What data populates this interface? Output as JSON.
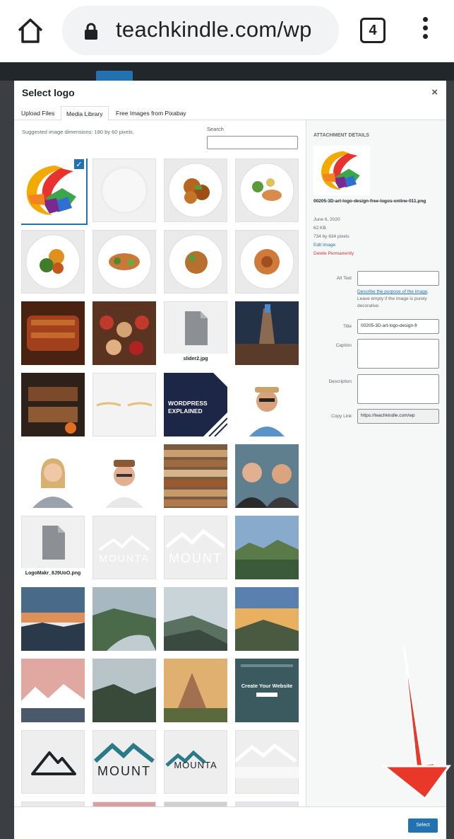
{
  "browser": {
    "url": "teachkindle.com/wp",
    "tab_count": "4"
  },
  "modal": {
    "title": "Select logo",
    "close": "×",
    "tabs": [
      "Upload Files",
      "Media Library",
      "Free Images from Pixabay"
    ],
    "hint": "Suggested image dimensions: 180 by 60 pixels.",
    "search_label": "Search",
    "search_value": ""
  },
  "grid_files": {
    "slider2": "slider2.jpg",
    "logomakr": "LogoMakr_8J9UoO.png"
  },
  "wordpress_tile": [
    "WORDPRESS",
    "EXPLAINED"
  ],
  "mountain_words": [
    "MOUNTA",
    "MOUNT",
    "MOUNT",
    "MOUNTA"
  ],
  "website_tile": "Create Your Website",
  "details": {
    "heading": "Attachment Details",
    "filename": "00205-3D-art-logo-design-free-logos-online-011.png",
    "date": "June 6, 2020",
    "size": "62 KB",
    "dims": "734 by 634 pixels",
    "edit": "Edit Image",
    "delete": "Delete Permanently",
    "alt_label": "Alt Text",
    "alt_value": "",
    "alt_help_link": "Describe the purpose of the image",
    "alt_help_rest": ". Leave empty if the image is purely decorative.",
    "title_label": "Title",
    "title_value": "00205-3D-art-logo-design-fr",
    "caption_label": "Caption",
    "description_label": "Description",
    "copylink_label": "Copy Link",
    "copylink_value": "https://teachkindle.com/wp"
  },
  "toolbar": {
    "select": "Select"
  },
  "colors": {
    "accent": "#2271b1",
    "danger": "#d63638",
    "arrow": "#e9382a"
  }
}
